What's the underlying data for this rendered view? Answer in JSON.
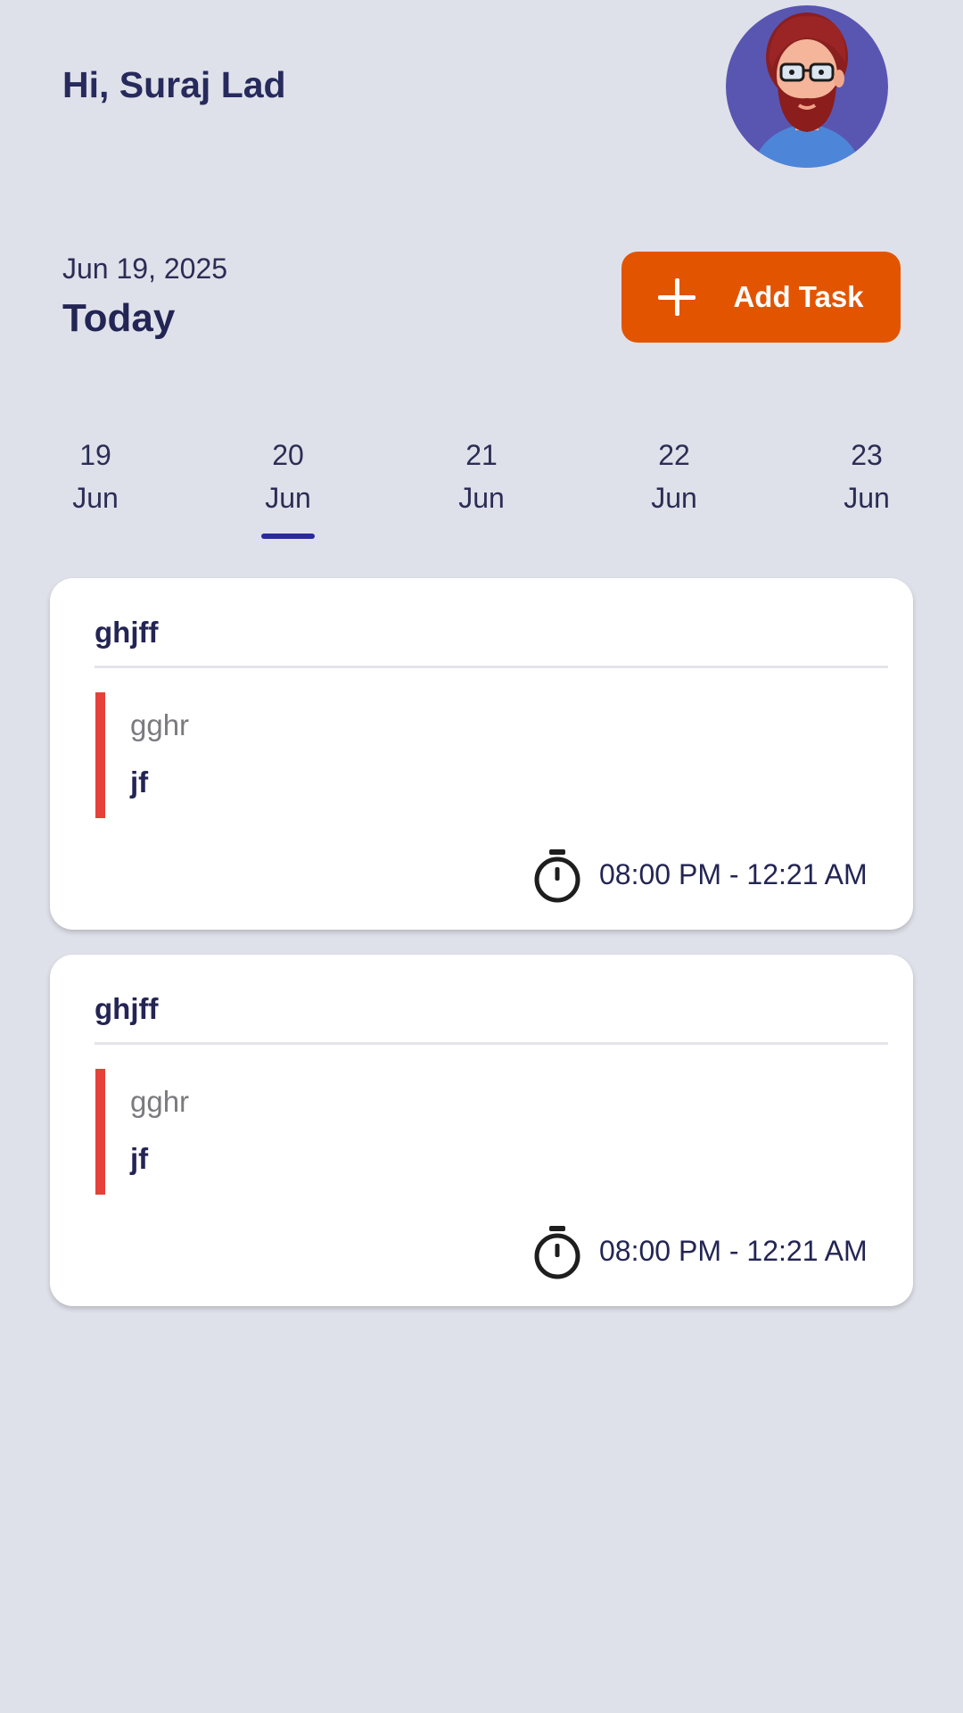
{
  "header": {
    "greeting": "Hi, Suraj Lad"
  },
  "date_row": {
    "date": "Jun 19, 2025",
    "label": "Today",
    "add_task_label": "Add Task"
  },
  "days": [
    {
      "num": "19",
      "month": "Jun"
    },
    {
      "num": "20",
      "month": "Jun",
      "selected": true
    },
    {
      "num": "21",
      "month": "Jun"
    },
    {
      "num": "22",
      "month": "Jun"
    },
    {
      "num": "23",
      "month": "Jun"
    }
  ],
  "tasks": [
    {
      "title": "ghjff",
      "description": "gghr",
      "note": "jf",
      "time": "08:00 PM - 12:21 AM"
    },
    {
      "title": "ghjff",
      "description": "gghr",
      "note": "jf",
      "time": "08:00 PM - 12:21 AM"
    }
  ],
  "colors": {
    "background": "#dfe1ea",
    "accent_button": "#e35400",
    "priority_bar": "#e5413a",
    "selected_underline": "#2a2a9a",
    "primary_text": "#232554"
  }
}
